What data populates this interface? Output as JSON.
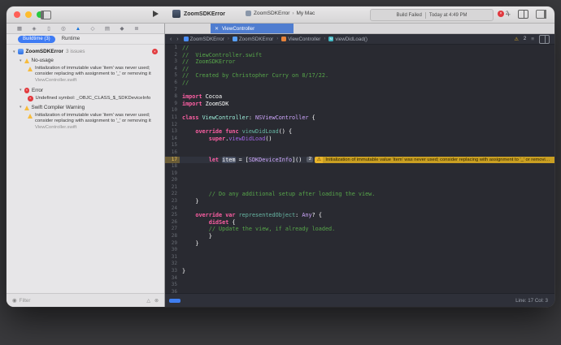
{
  "colors": {
    "accent_blue": "#3478f6",
    "warning_yellow": "#e7b32a",
    "error_red": "#e0383e"
  },
  "toolbar": {
    "window_title": "ZoomSDKError",
    "scheme": "ZoomSDKError",
    "destination": "My Mac",
    "status_title": "Build Failed",
    "status_time": "Today at 4:49 PM",
    "error_count": "2"
  },
  "navigator": {
    "icon_strip": [
      {
        "name": "project-navigator-icon",
        "glyph": "▦"
      },
      {
        "name": "source-control-navigator-icon",
        "glyph": "◈"
      },
      {
        "name": "bookmarks-navigator-icon",
        "glyph": "▯"
      },
      {
        "name": "find-navigator-icon",
        "glyph": "◎"
      },
      {
        "name": "issues-navigator-icon",
        "glyph": "▲",
        "selected": true
      },
      {
        "name": "tests-navigator-icon",
        "glyph": "◇"
      },
      {
        "name": "debug-navigator-icon",
        "glyph": "▤"
      },
      {
        "name": "breakpoints-navigator-icon",
        "glyph": "◆"
      },
      {
        "name": "reports-navigator-icon",
        "glyph": "≣"
      }
    ],
    "scope_tabs": {
      "buildtime": "Buildtime (3)",
      "runtime": "Runtime"
    },
    "root": {
      "title": "ZoomSDKError",
      "subtitle": "3 issues"
    },
    "groups": [
      {
        "kind": "warning",
        "title": "No-usage",
        "items": [
          {
            "kind": "warning",
            "text": "Initialization of immutable value 'item' was never used; consider replacing with assignment to '_' or removing it",
            "file": "ViewController.swift"
          }
        ]
      },
      {
        "kind": "error",
        "title": "Error",
        "items": [
          {
            "kind": "error",
            "text": "Undefined symbol: _OBJC_CLASS_$_SDKDeviceInfo"
          }
        ]
      },
      {
        "kind": "warning",
        "title": "Swift Compiler Warning",
        "items": [
          {
            "kind": "warning",
            "text": "Initialization of immutable value 'item' was never used; consider replacing with assignment to '_' or removing it",
            "file": "ViewController.swift"
          }
        ]
      }
    ],
    "filter_placeholder": "Filter"
  },
  "editor": {
    "tab_title": "ViewController",
    "breadcrumb": [
      {
        "label": "ZoomSDKError",
        "icon": "project"
      },
      {
        "label": "ZoomSDKError",
        "icon": "folder"
      },
      {
        "label": "ViewController",
        "icon": "file"
      },
      {
        "label": "viewDidLoad()",
        "icon": "method"
      }
    ],
    "issue_indicator": "2",
    "inline_warning": {
      "badge": "2",
      "text": "Initialization of immutable value 'item' was never used; consider replacing with assignment to '_' or removing it"
    },
    "status_line": "Line: 17  Col: 3",
    "code": {
      "lines": [
        {
          "t": [
            [
              "//",
              "c"
            ]
          ]
        },
        {
          "t": [
            [
              "//  ViewController.swift",
              "c"
            ]
          ]
        },
        {
          "t": [
            [
              "//  ZoomSDKError",
              "c"
            ]
          ]
        },
        {
          "t": [
            [
              "//",
              "c"
            ]
          ]
        },
        {
          "t": [
            [
              "//  Created by Christopher Curry on 8/17/22.",
              "c"
            ]
          ]
        },
        {
          "t": [
            [
              "//",
              "c"
            ]
          ]
        },
        {
          "t": []
        },
        {
          "t": [
            [
              "import",
              "k"
            ],
            [
              " Cocoa",
              "p"
            ]
          ]
        },
        {
          "t": [
            [
              "import",
              "k"
            ],
            [
              " ZoomSDK",
              "p"
            ]
          ]
        },
        {
          "t": []
        },
        {
          "t": [
            [
              "class",
              "k"
            ],
            [
              " ",
              "p"
            ],
            [
              "ViewController",
              "tp"
            ],
            [
              ": ",
              "p"
            ],
            [
              "NSViewController",
              "ts"
            ],
            [
              " {",
              "p"
            ]
          ]
        },
        {
          "t": []
        },
        {
          "t": [
            [
              "    ",
              "p"
            ],
            [
              "override",
              "k"
            ],
            [
              " ",
              "p"
            ],
            [
              "func",
              "k"
            ],
            [
              " ",
              "p"
            ],
            [
              "viewDidLoad",
              "fp"
            ],
            [
              "() {",
              "p"
            ]
          ]
        },
        {
          "t": [
            [
              "        ",
              "p"
            ],
            [
              "super",
              "k"
            ],
            [
              ".",
              "p"
            ],
            [
              "viewDidLoad",
              "fs"
            ],
            [
              "()",
              "p"
            ]
          ]
        },
        {
          "t": []
        },
        {
          "t": []
        },
        {
          "t": [
            [
              "        ",
              "p"
            ],
            [
              "let",
              "k"
            ],
            [
              " ",
              "p"
            ],
            [
              "item",
              "p",
              1
            ],
            [
              " = [",
              "p"
            ],
            [
              "SDKDeviceInfo",
              "ts"
            ],
            [
              "]()",
              "p"
            ]
          ],
          "cur": true,
          "warn": true
        },
        {
          "t": []
        },
        {
          "t": []
        },
        {
          "t": []
        },
        {
          "t": []
        },
        {
          "t": [
            [
              "        // Do any additional setup after loading the view.",
              "c"
            ]
          ]
        },
        {
          "t": [
            [
              "    }",
              "p"
            ]
          ]
        },
        {
          "t": []
        },
        {
          "t": [
            [
              "    ",
              "p"
            ],
            [
              "override",
              "k"
            ],
            [
              " ",
              "p"
            ],
            [
              "var",
              "k"
            ],
            [
              " ",
              "p"
            ],
            [
              "representedObject",
              "fp"
            ],
            [
              ": ",
              "p"
            ],
            [
              "Any",
              "ts"
            ],
            [
              "? {",
              "p"
            ]
          ]
        },
        {
          "t": [
            [
              "        ",
              "p"
            ],
            [
              "didSet",
              "k"
            ],
            [
              " {",
              "p"
            ]
          ]
        },
        {
          "t": [
            [
              "        // Update the view, if already loaded.",
              "c"
            ]
          ]
        },
        {
          "t": [
            [
              "        }",
              "p"
            ]
          ]
        },
        {
          "t": [
            [
              "    }",
              "p"
            ]
          ]
        },
        {
          "t": []
        },
        {
          "t": []
        },
        {
          "t": []
        },
        {
          "t": [
            [
              "}",
              "p"
            ]
          ]
        },
        {
          "t": []
        },
        {
          "t": []
        },
        {
          "t": []
        }
      ]
    }
  }
}
